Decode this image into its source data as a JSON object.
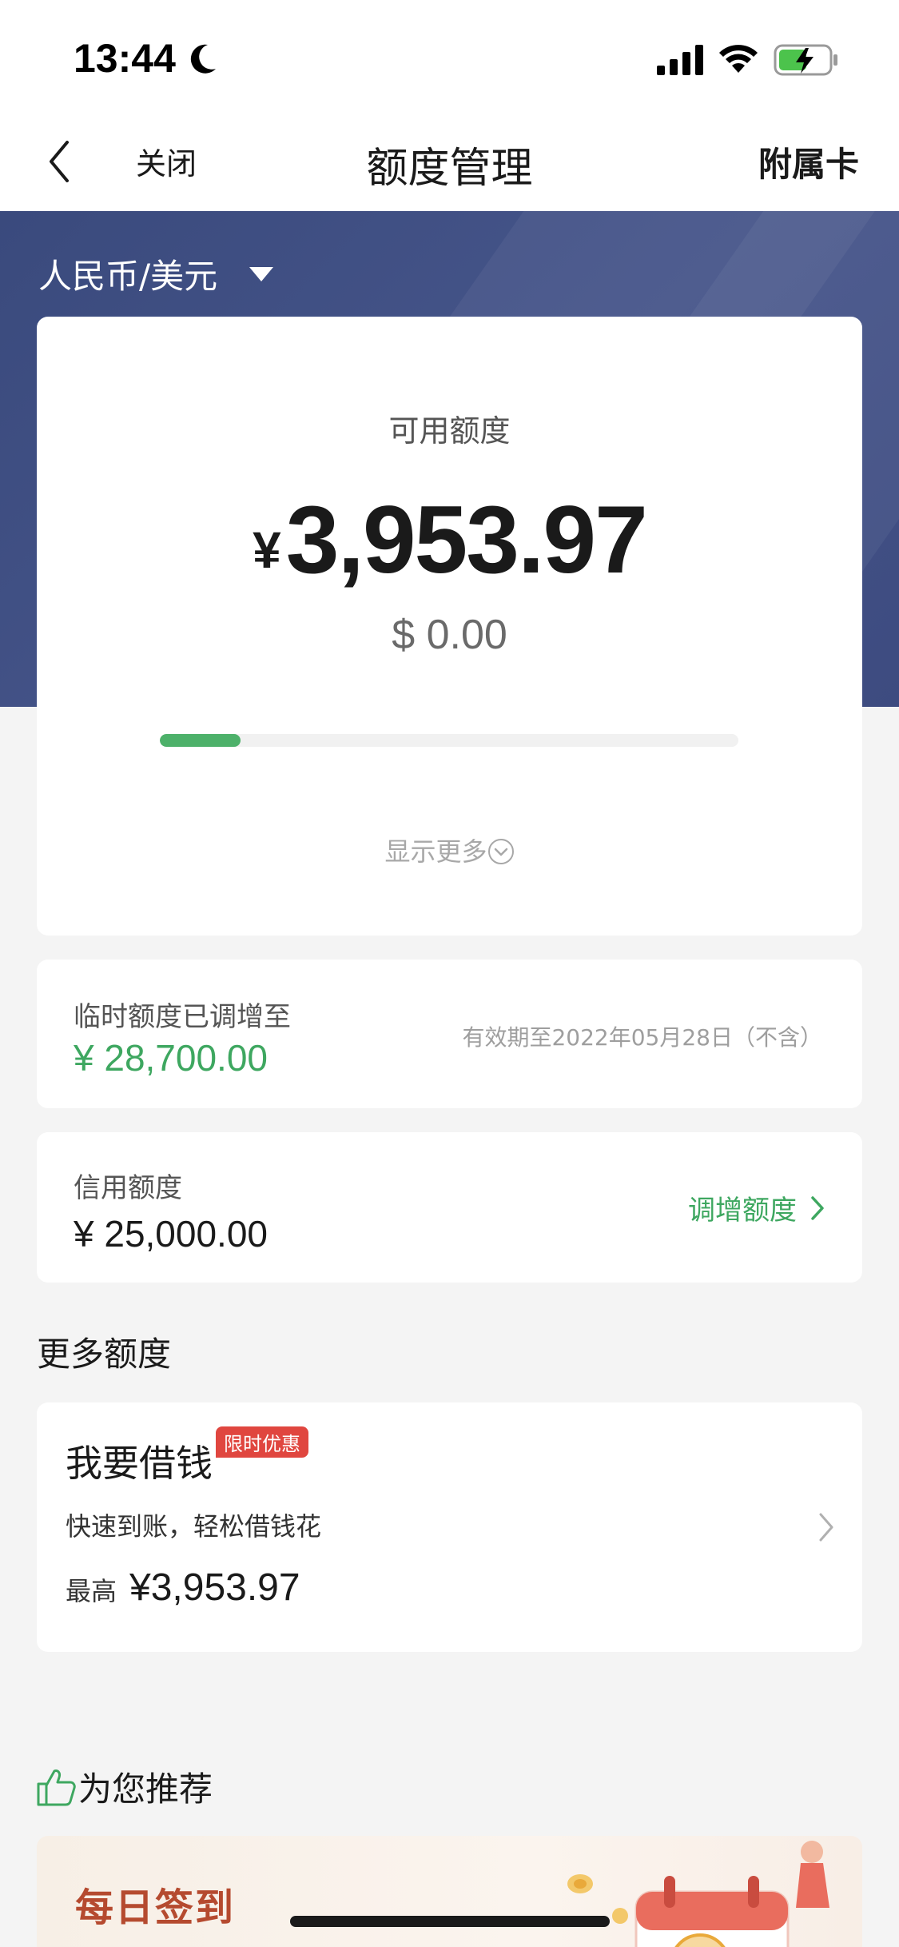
{
  "status_bar": {
    "time": "13:44"
  },
  "nav": {
    "close_label": "关闭",
    "title": "额度管理",
    "right_label": "附属卡"
  },
  "currency": {
    "label": "人民币/美元"
  },
  "available": {
    "label": "可用额度",
    "cny_symbol": "¥",
    "cny_amount": "3,953.97",
    "usd_amount": "$ 0.00",
    "usage_fraction": 0.14,
    "show_more": "显示更多"
  },
  "temp_limit": {
    "title": "临时额度已调增至",
    "amount": "¥ 28,700.00",
    "validity": "有效期至2022年05月28日（不含）"
  },
  "credit_limit": {
    "title": "信用额度",
    "amount": "¥ 25,000.00",
    "raise_label": "调增额度"
  },
  "more_limits": {
    "title": "更多额度"
  },
  "loan": {
    "title": "我要借钱",
    "badge": "限时优惠",
    "subtitle": "快速到账，轻松借钱花",
    "max_label": "最高",
    "max_amount": "¥3,953.97"
  },
  "recommend": {
    "title": "为您推荐"
  },
  "promo": {
    "title": "每日签到"
  },
  "colors": {
    "header_blue": "#3f4e83",
    "accent_green": "#3ea760",
    "badge_red": "#e0463f",
    "promo_text": "#b54a2f"
  },
  "icons": [
    "moon-icon",
    "signal-icon",
    "wifi-icon",
    "battery-charging-icon",
    "back-arrow-icon",
    "caret-down-icon",
    "chevron-down-circle-icon",
    "chevron-right-icon",
    "thumbs-up-icon"
  ]
}
